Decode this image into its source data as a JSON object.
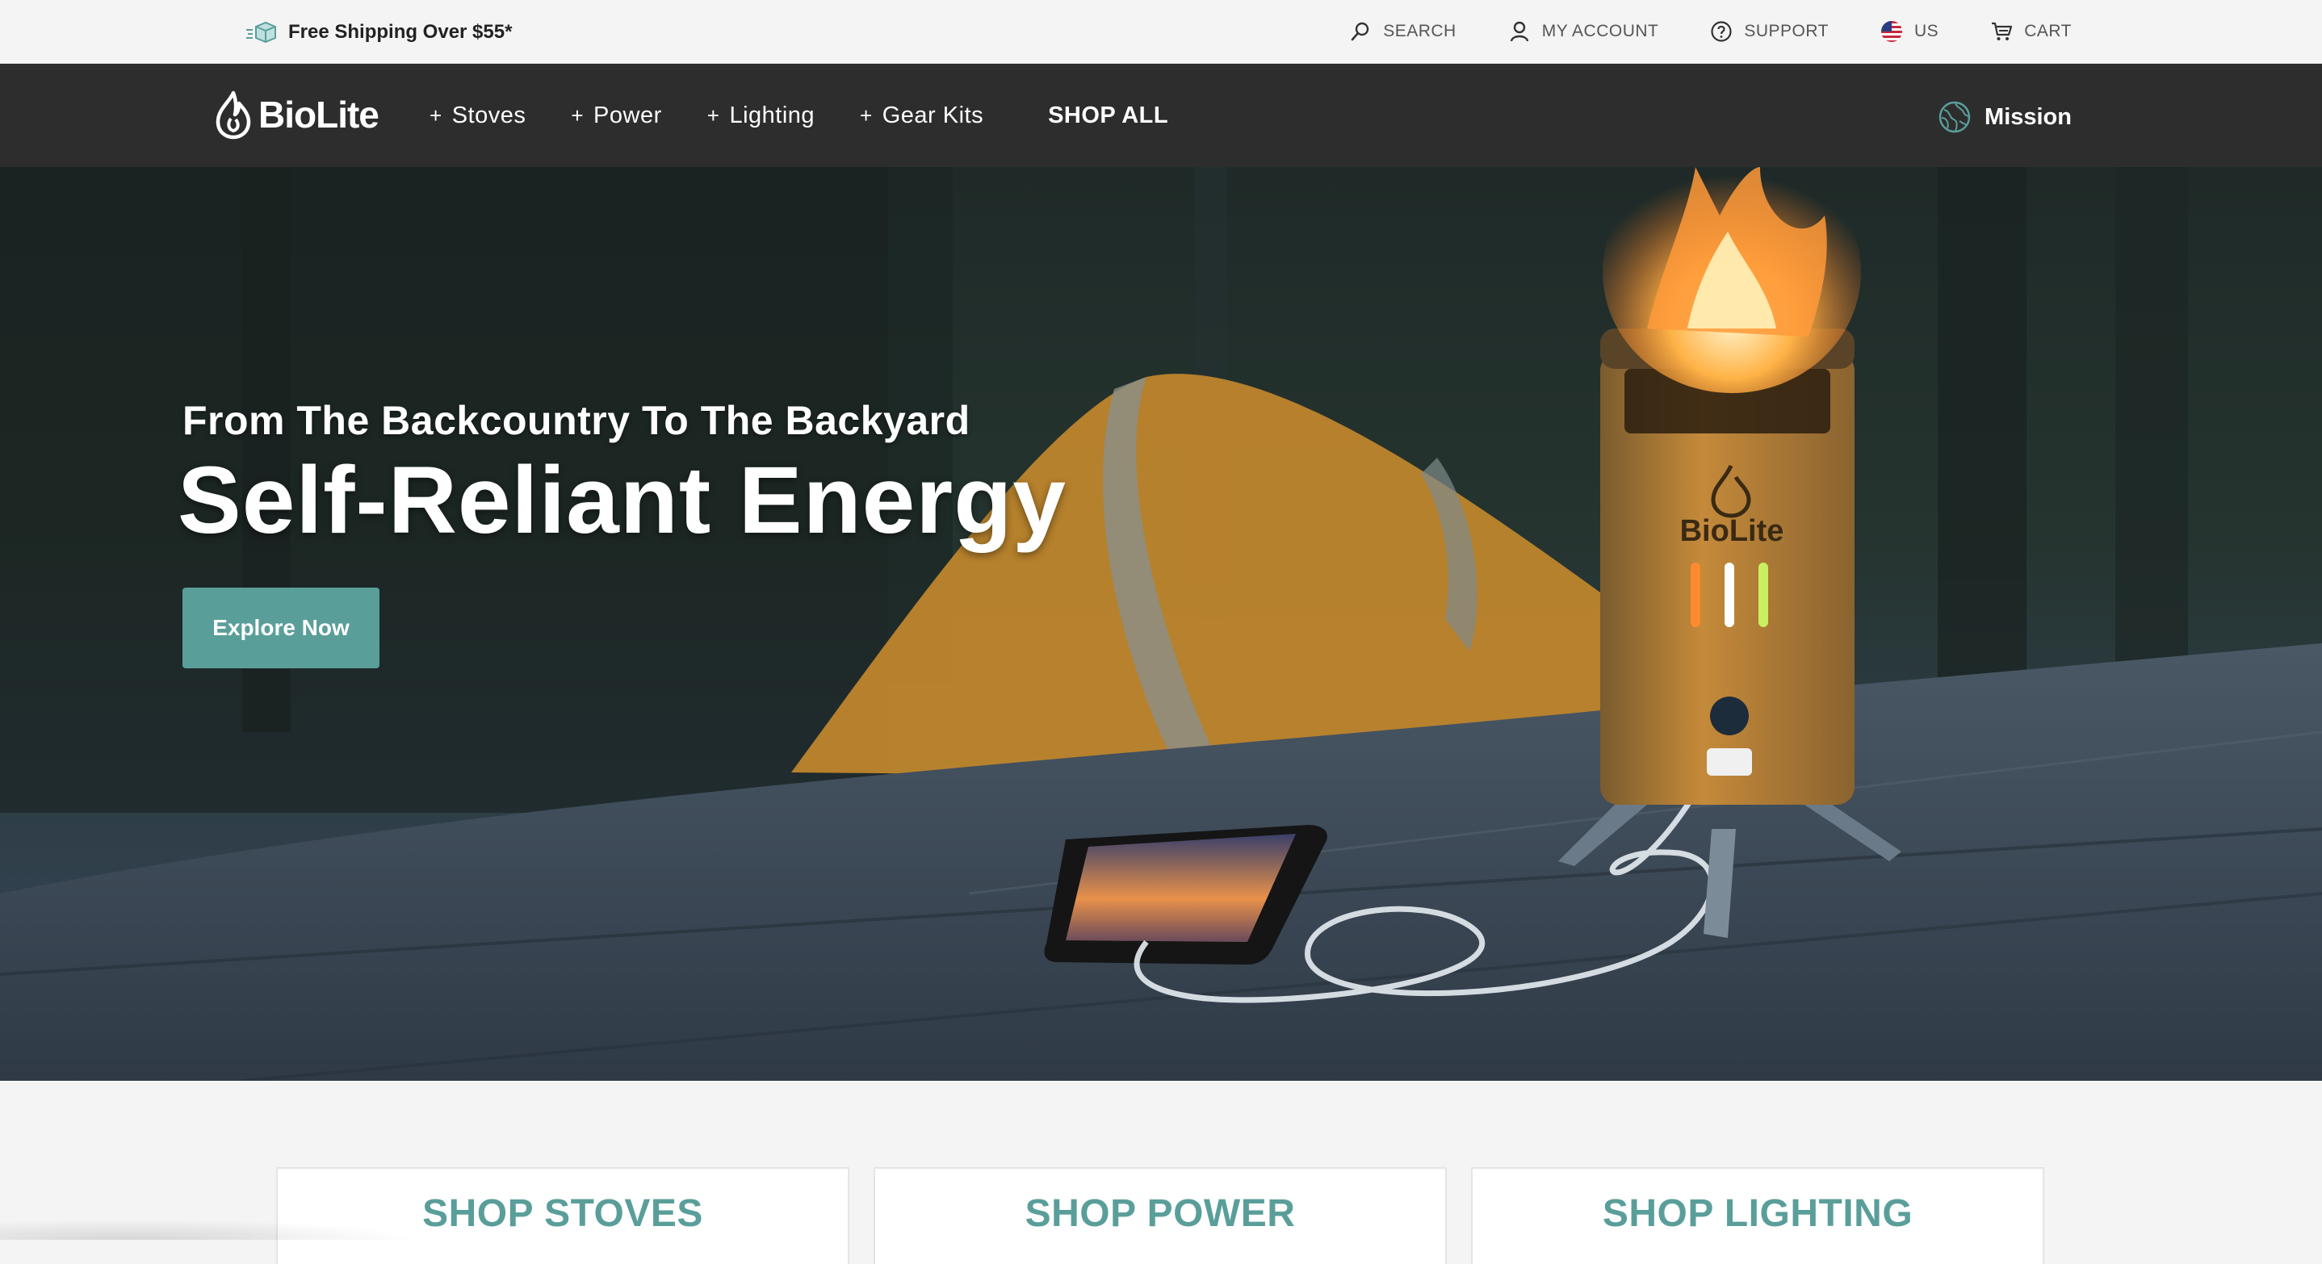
{
  "utility_bar": {
    "shipping": "Free Shipping Over $55*",
    "links": {
      "search": "SEARCH",
      "account": "MY ACCOUNT",
      "support": "SUPPORT",
      "region": "US",
      "cart": "CART"
    }
  },
  "nav": {
    "logo": "BioLite",
    "items": [
      "Stoves",
      "Power",
      "Lighting",
      "Gear Kits"
    ],
    "shop_all": "SHOP ALL",
    "mission": "Mission"
  },
  "hero": {
    "subtitle": "From The Backcountry To The Backyard",
    "title": "Self-Reliant Energy",
    "cta": "Explore Now",
    "stove_brand": "BioLite"
  },
  "categories": [
    "SHOP STOVES",
    "SHOP POWER",
    "SHOP LIGHTING"
  ],
  "colors": {
    "accent": "#5a9e9a",
    "nav_bg": "#2d2d2d",
    "utility_bg": "#f4f4f4"
  },
  "icons": {
    "shipping": "box-icon",
    "search": "search-icon",
    "account": "user-icon",
    "support": "help-circle-icon",
    "region": "us-flag-icon",
    "cart": "cart-icon",
    "logo": "flame-icon",
    "mission": "globe-icon"
  }
}
